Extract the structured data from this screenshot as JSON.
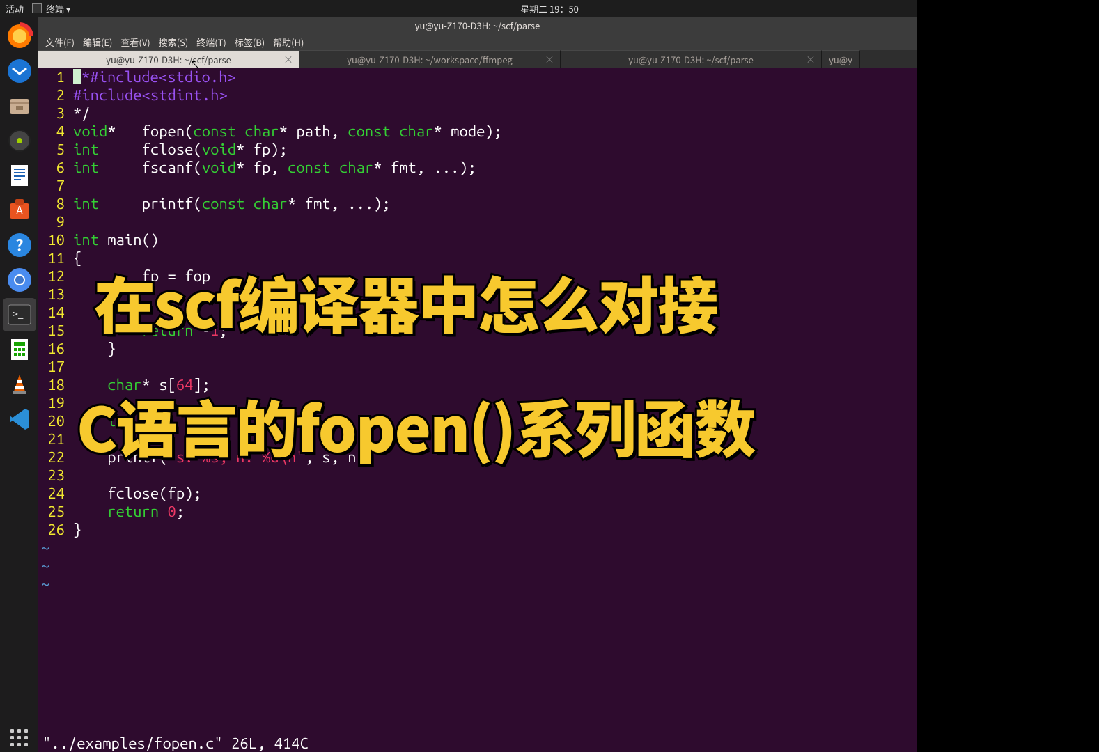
{
  "topbar": {
    "activities": "活动",
    "app": "终端 ▾",
    "datetime": "星期二 19：50"
  },
  "window_title": "yu@yu-Z170-D3H: ~/scf/parse",
  "menu": {
    "file": "文件(F)",
    "edit": "编辑(E)",
    "view": "查看(V)",
    "search": "搜索(S)",
    "terminal": "终端(T)",
    "tabs": "标签(B)",
    "help": "帮助(H)"
  },
  "tabs": [
    {
      "label": "yu@yu-Z170-D3H: ~/scf/parse",
      "active": true
    },
    {
      "label": "yu@yu-Z170-D3H: ~/workspace/ffmpeg",
      "active": false
    },
    {
      "label": "yu@yu-Z170-D3H: ~/scf/parse",
      "active": false
    },
    {
      "label": "yu@y",
      "active": false,
      "clipped": true
    }
  ],
  "code": {
    "lines": [
      {
        "n": 1,
        "html": "<span class='cursor'></span><span class='c-pre'>*#include&lt;stdio.h&gt;</span>"
      },
      {
        "n": 2,
        "html": "<span class='c-pre'>#include&lt;stdint.h&gt;</span>"
      },
      {
        "n": 3,
        "html": "<span class='c-txt'>*/</span>"
      },
      {
        "n": 4,
        "html": "<span class='c-kw'>void</span><span class='c-txt'>*   fopen(</span><span class='c-kw'>const</span><span class='c-txt'> </span><span class='c-kw'>char</span><span class='c-txt'>* path, </span><span class='c-kw'>const</span><span class='c-txt'> </span><span class='c-kw'>char</span><span class='c-txt'>* mode);</span>"
      },
      {
        "n": 5,
        "html": "<span class='c-kw'>int</span><span class='c-txt'>     fclose(</span><span class='c-kw'>void</span><span class='c-txt'>* fp);</span>"
      },
      {
        "n": 6,
        "html": "<span class='c-kw'>int</span><span class='c-txt'>     fscanf(</span><span class='c-kw'>void</span><span class='c-txt'>* fp, </span><span class='c-kw'>const</span><span class='c-txt'> </span><span class='c-kw'>char</span><span class='c-txt'>* fmt, ...);</span>"
      },
      {
        "n": 7,
        "html": ""
      },
      {
        "n": 8,
        "html": "<span class='c-kw'>int</span><span class='c-txt'>     printf(</span><span class='c-kw'>const</span><span class='c-txt'> </span><span class='c-kw'>char</span><span class='c-txt'>* fmt, ...);</span>"
      },
      {
        "n": 9,
        "html": ""
      },
      {
        "n": 10,
        "html": "<span class='c-kw'>int</span><span class='c-txt'> main()</span>"
      },
      {
        "n": 11,
        "html": "<span class='c-txt'>{</span>"
      },
      {
        "n": 12,
        "html": "<span class='c-txt'>        fp = fop</span>"
      },
      {
        "n": 13,
        "html": ""
      },
      {
        "n": 14,
        "html": ""
      },
      {
        "n": 15,
        "html": "<span class='c-txt'>        </span><span class='c-kw'>return</span><span class='c-txt'> -</span><span class='c-num'>1</span><span class='c-txt'>;</span>"
      },
      {
        "n": 16,
        "html": "<span class='c-txt'>    }</span>"
      },
      {
        "n": 17,
        "html": ""
      },
      {
        "n": 18,
        "html": "<span class='c-txt'>    </span><span class='c-kw'>char</span><span class='c-txt'>* s[</span><span class='c-num'>64</span><span class='c-txt'>];</span>"
      },
      {
        "n": 19,
        "html": ""
      },
      {
        "n": 20,
        "html": "<span class='c-txt'>    </span><span class='c-kw'>int</span><span class='c-txt'>   a</span>"
      },
      {
        "n": 21,
        "html": ""
      },
      {
        "n": 22,
        "html": "<span class='c-txt'>    printf(</span><span class='c-str'>\"s: %s, n: %d</span><span class='c-const'>\\n</span><span class='c-str'>\"</span><span class='c-txt'>, s, n);</span>"
      },
      {
        "n": 23,
        "html": ""
      },
      {
        "n": 24,
        "html": "<span class='c-txt'>    fclose(fp);</span>"
      },
      {
        "n": 25,
        "html": "<span class='c-txt'>    </span><span class='c-kw'>return</span><span class='c-txt'> </span><span class='c-num'>0</span><span class='c-txt'>;</span>"
      },
      {
        "n": 26,
        "html": "<span class='c-txt'>}</span>"
      }
    ],
    "tildes": 3
  },
  "status_line": "\"../examples/fopen.c\" 26L, 414C",
  "overlay": {
    "line1": "在scf编译器中怎么对接",
    "line2": "C语言的fopen()系列函数"
  },
  "dock_icons": [
    "firefox",
    "thunderbird",
    "files",
    "disk",
    "writer",
    "software",
    "help",
    "chromium",
    "terminal",
    "calc",
    "vlc",
    "vscode"
  ]
}
